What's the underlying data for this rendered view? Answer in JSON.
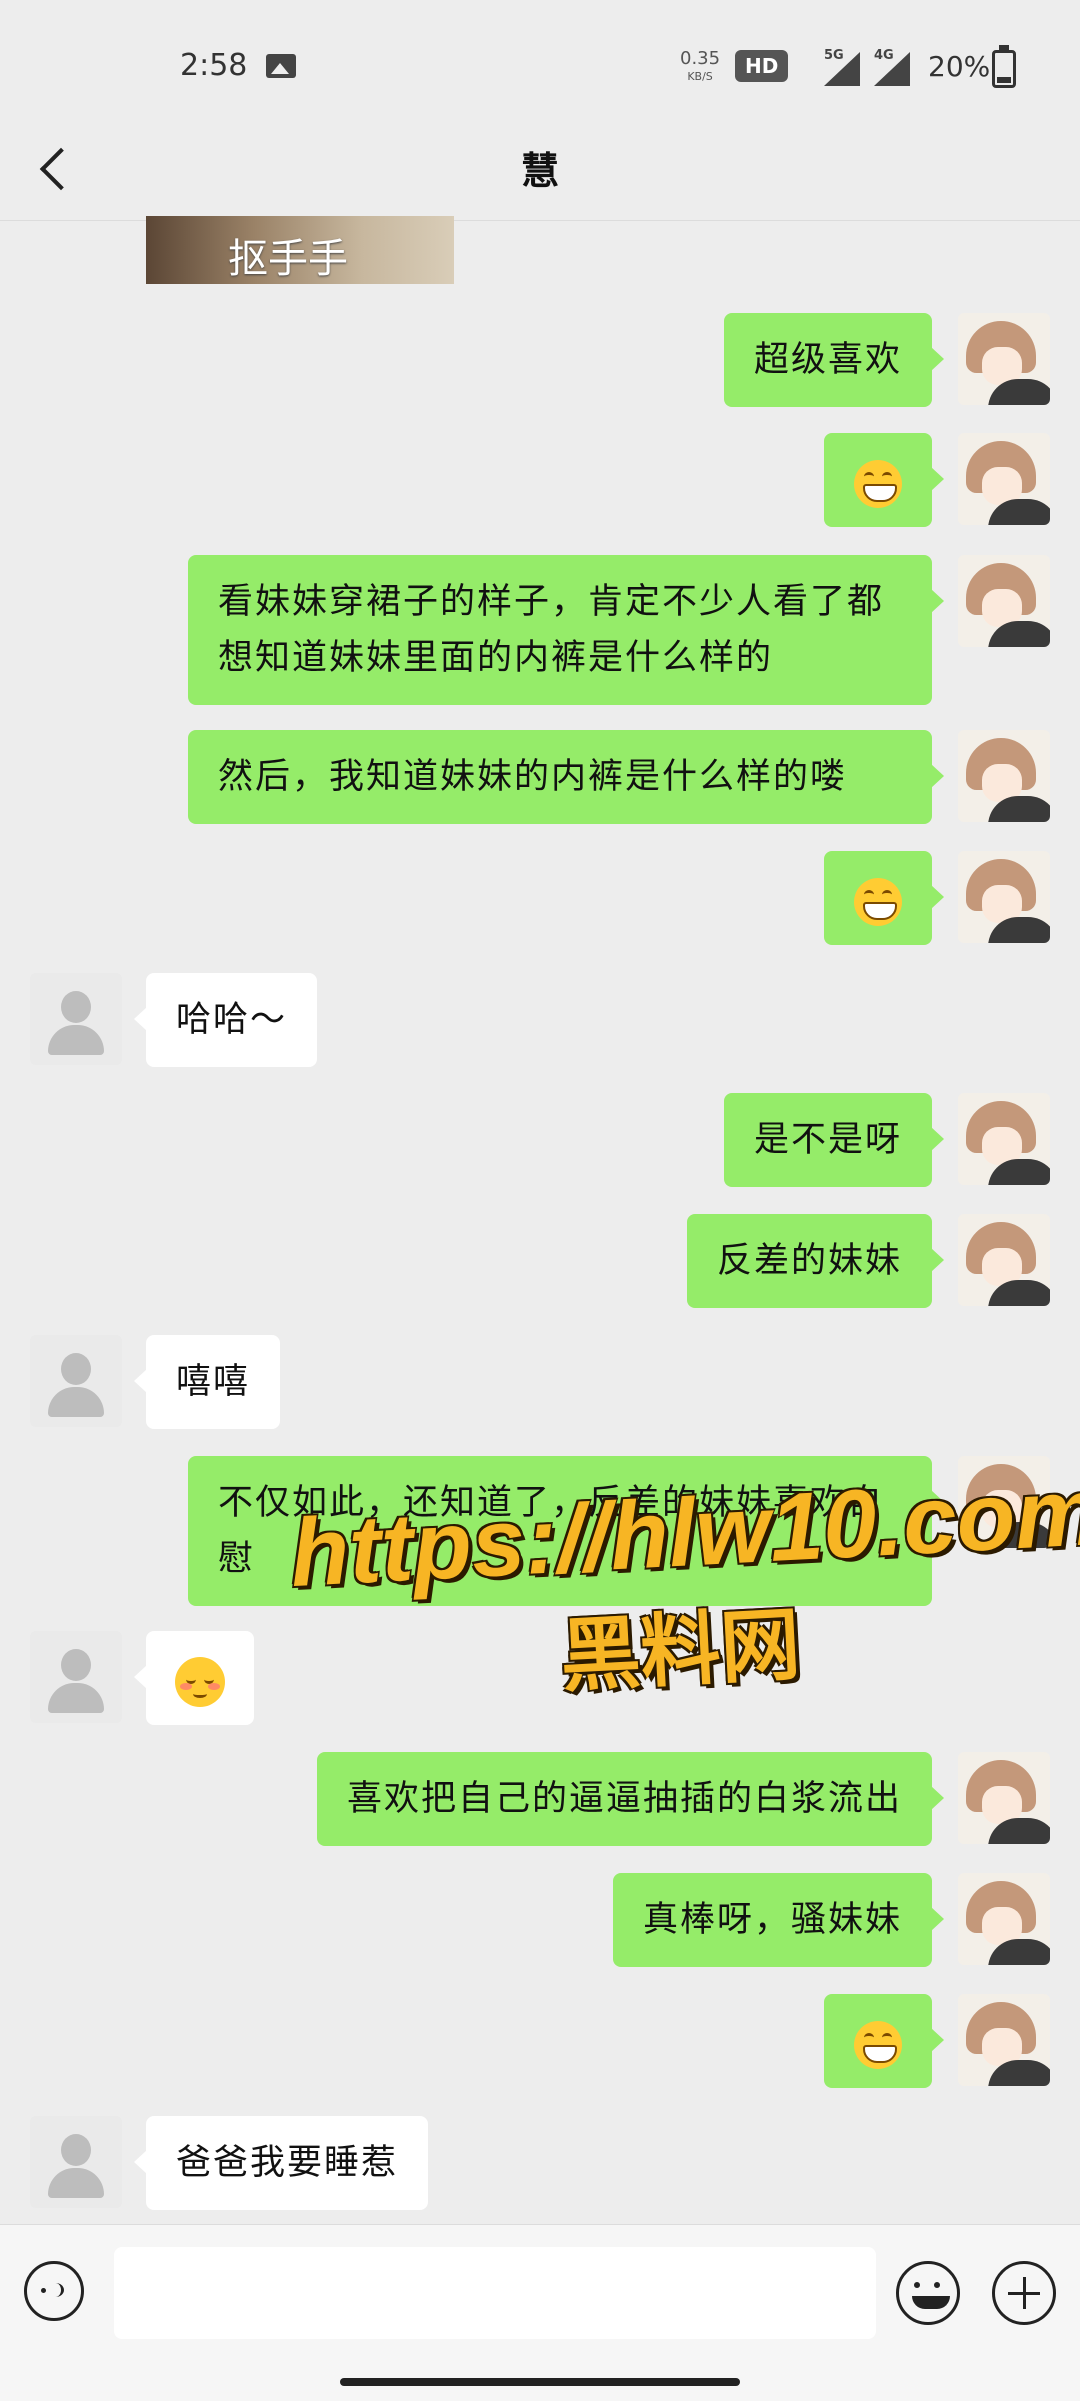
{
  "status_bar": {
    "time": "2:58",
    "net_speed": "0.35",
    "net_unit": "KB/S",
    "hd": "HD",
    "signal1": "5G",
    "signal2": "4G",
    "battery": "20%"
  },
  "header": {
    "title": "慧",
    "back_icon": "chevron-left-icon"
  },
  "image_message": {
    "caption": "抠手手"
  },
  "messages": [
    {
      "side": "out",
      "text": "超级喜欢"
    },
    {
      "side": "out",
      "emoji": "grin-emoji"
    },
    {
      "side": "out",
      "text": "看妹妹穿裙子的样子，肯定不少人看了都想知道妹妹里面的内裤是什么样的"
    },
    {
      "side": "out",
      "text": "然后，我知道妹妹的内裤是什么样的喽"
    },
    {
      "side": "out",
      "emoji": "grin-emoji"
    },
    {
      "side": "in",
      "text": "哈哈～"
    },
    {
      "side": "out",
      "text": "是不是呀"
    },
    {
      "side": "out",
      "text": "反差的妹妹"
    },
    {
      "side": "in",
      "text": "嘻嘻"
    },
    {
      "side": "out",
      "text": "不仅如此，还知道了，反差的妹妹喜欢自慰"
    },
    {
      "side": "in",
      "emoji": "shy-emoji"
    },
    {
      "side": "out",
      "text": "喜欢把自己的逼逼抽插的白浆流出"
    },
    {
      "side": "out",
      "text": "真棒呀，骚妹妹"
    },
    {
      "side": "out",
      "emoji": "grin-emoji"
    },
    {
      "side": "in",
      "text": "爸爸我要睡惹"
    }
  ],
  "watermark": {
    "line1": "https://hlw10.com",
    "line2": "黑料网"
  },
  "input_bar": {
    "value": "",
    "placeholder": ""
  },
  "colors": {
    "out_bubble": "#95ec69",
    "in_bubble": "#ffffff",
    "background": "#ededed"
  }
}
